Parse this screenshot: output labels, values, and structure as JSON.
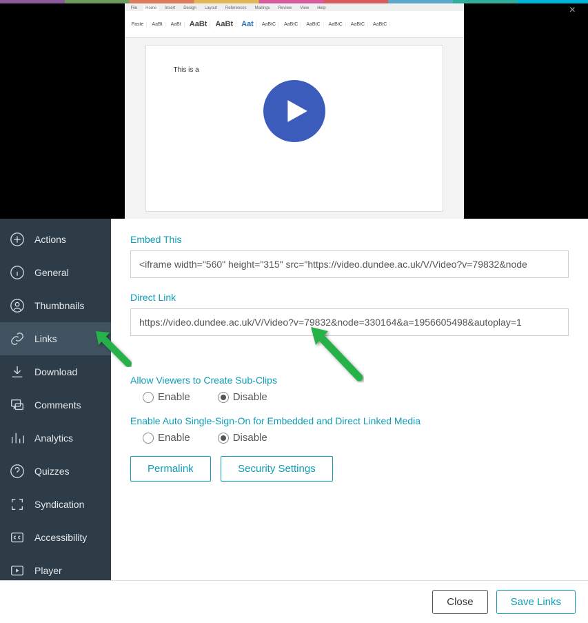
{
  "close_x": "×",
  "preview": {
    "doc_text": "This is a",
    "ribbon_tabs": [
      "File",
      "Home",
      "Insert",
      "Design",
      "Layout",
      "References",
      "Mailings",
      "Review",
      "View",
      "Help"
    ]
  },
  "sidebar": {
    "items": [
      {
        "label": "Actions"
      },
      {
        "label": "General"
      },
      {
        "label": "Thumbnails"
      },
      {
        "label": "Links"
      },
      {
        "label": "Download"
      },
      {
        "label": "Comments"
      },
      {
        "label": "Analytics"
      },
      {
        "label": "Quizzes"
      },
      {
        "label": "Syndication"
      },
      {
        "label": "Accessibility"
      },
      {
        "label": "Player"
      }
    ]
  },
  "content": {
    "embed_label": "Embed This",
    "embed_value": "<iframe width=\"560\" height=\"315\" src=\"https://video.dundee.ac.uk/V/Video?v=79832&node",
    "direct_label": "Direct Link",
    "direct_value": "https://video.dundee.ac.uk/V/Video?v=79832&node=330164&a=1956605498&autoplay=1",
    "subclips_label": "Allow Viewers to Create Sub-Clips",
    "sso_label": "Enable Auto Single-Sign-On for Embedded and Direct Linked Media",
    "enable": "Enable",
    "disable": "Disable",
    "permalink": "Permalink",
    "security": "Security Settings"
  },
  "footer": {
    "close": "Close",
    "save": "Save Links"
  }
}
